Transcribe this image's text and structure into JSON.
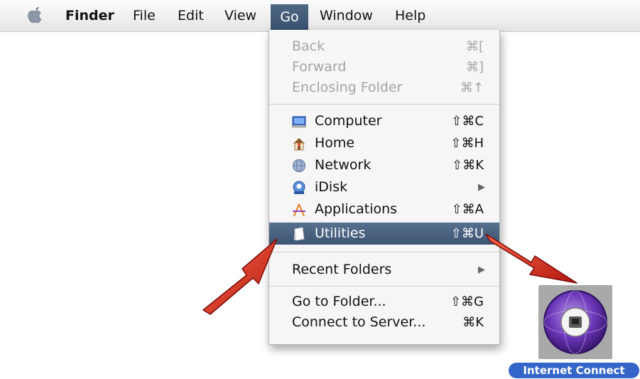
{
  "menubar": {
    "items": [
      "Finder",
      "File",
      "Edit",
      "View",
      "Go",
      "Window",
      "Help"
    ]
  },
  "go_menu": {
    "back": {
      "label": "Back",
      "shortcut": "⌘["
    },
    "forward": {
      "label": "Forward",
      "shortcut": "⌘]"
    },
    "enclosing": {
      "label": "Enclosing Folder",
      "shortcut": "⌘↑"
    },
    "computer": {
      "label": "Computer",
      "shortcut": "⇧⌘C"
    },
    "home": {
      "label": "Home",
      "shortcut": "⇧⌘H"
    },
    "network": {
      "label": "Network",
      "shortcut": "⇧⌘K"
    },
    "idisk": {
      "label": "iDisk",
      "submenu": "▶"
    },
    "applications": {
      "label": "Applications",
      "shortcut": "⇧⌘A"
    },
    "utilities": {
      "label": "Utilities",
      "shortcut": "⇧⌘U"
    },
    "recent": {
      "label": "Recent Folders",
      "submenu": "▶"
    },
    "goto": {
      "label": "Go to Folder...",
      "shortcut": "⇧⌘G"
    },
    "connect": {
      "label": "Connect to Server...",
      "shortcut": "⌘K"
    }
  },
  "desktop": {
    "app_label": "Internet Connect",
    "app_icon": "internet-connect-icon"
  },
  "colors": {
    "highlight": "#3d5573",
    "label_bg": "#3466c9",
    "arrow": "#d9261c"
  }
}
